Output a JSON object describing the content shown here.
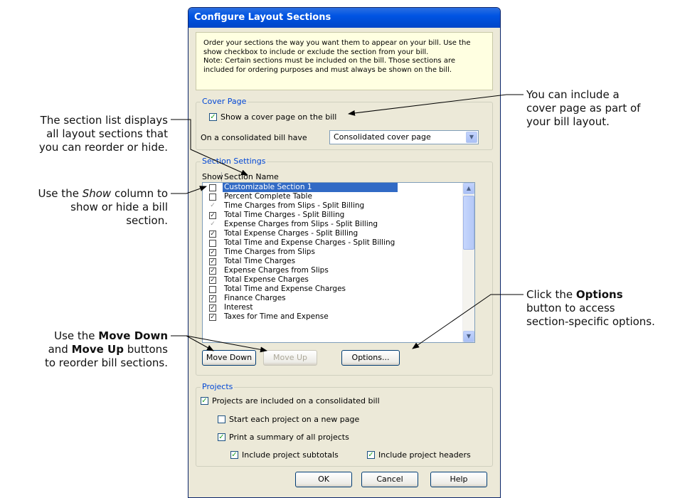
{
  "dialog": {
    "title": "Configure Layout Sections",
    "info_lines": [
      "Order your sections the way you want them to appear on your bill. Use the",
      "show checkbox to include or exclude the section from your bill.",
      "Note: Certain sections must be included on the bill. Those sections are",
      "included for ordering purposes and must always be shown on the bill."
    ]
  },
  "cover_page": {
    "group_title": "Cover Page",
    "show_checkbox_label": "Show a cover page on the bill",
    "consolidated_label": "On a consolidated bill have",
    "consolidated_value": "Consolidated cover page"
  },
  "section_settings": {
    "group_title": "Section Settings",
    "col_show": "Show",
    "col_name": "Section Name",
    "items": [
      {
        "name": "Customizable Section 1",
        "state": "unchecked",
        "selected": true
      },
      {
        "name": "Percent Complete Table",
        "state": "unchecked"
      },
      {
        "name": "Time Charges from Slips - Split Billing",
        "state": "gray"
      },
      {
        "name": "Total Time Charges - Split Billing",
        "state": "checked"
      },
      {
        "name": "Expense Charges from Slips - Split Billing",
        "state": "gray"
      },
      {
        "name": "Total Expense Charges - Split Billing",
        "state": "checked"
      },
      {
        "name": "Total Time and Expense Charges - Split Billing",
        "state": "unchecked"
      },
      {
        "name": "Time Charges from Slips",
        "state": "checked"
      },
      {
        "name": "Total Time Charges",
        "state": "checked"
      },
      {
        "name": "Expense Charges from Slips",
        "state": "checked"
      },
      {
        "name": "Total Expense Charges",
        "state": "checked"
      },
      {
        "name": "Total Time and Expense Charges",
        "state": "unchecked"
      },
      {
        "name": "Finance Charges",
        "state": "checked"
      },
      {
        "name": "Interest",
        "state": "checked"
      },
      {
        "name": "Taxes for Time and Expense",
        "state": "checked"
      }
    ],
    "buttons": {
      "move_down": "Move Down",
      "move_up": "Move Up",
      "options": "Options..."
    }
  },
  "projects": {
    "group_title": "Projects",
    "included_label": "Projects are included on a consolidated bill",
    "new_page_label": "Start each project on a new page",
    "summary_label": "Print a summary of all projects",
    "subtotals_label": "Include project subtotals",
    "headers_label": "Include project headers"
  },
  "footer_buttons": {
    "ok": "OK",
    "cancel": "Cancel",
    "help": "Help"
  },
  "callouts": {
    "section_list": [
      "The section list displays",
      "all layout sections that",
      "you can reorder or hide."
    ],
    "show_column": {
      "pre": "Use the ",
      "em": "Show",
      "post": " column to",
      "line2": "show or hide a bill",
      "line3": "section."
    },
    "move_buttons": {
      "l1_pre": "Use the ",
      "l1_bold": "Move Down",
      "l2_pre": "and ",
      "l2_bold": "Move Up",
      "l2_post": " buttons",
      "l3": "to reorder bill sections."
    },
    "cover_page": [
      "You can include a",
      "cover page as part of",
      "your bill layout."
    ],
    "options": {
      "l1_pre": "Click the ",
      "l1_bold": "Options",
      "l2": "button to access",
      "l3": "section-specific options."
    }
  },
  "colors": {
    "title_bar": "#0054e3",
    "selection": "#316ac5",
    "group_title": "#0046d5",
    "info_bg": "#ffffe1",
    "dialog_bg": "#ece9d8"
  }
}
